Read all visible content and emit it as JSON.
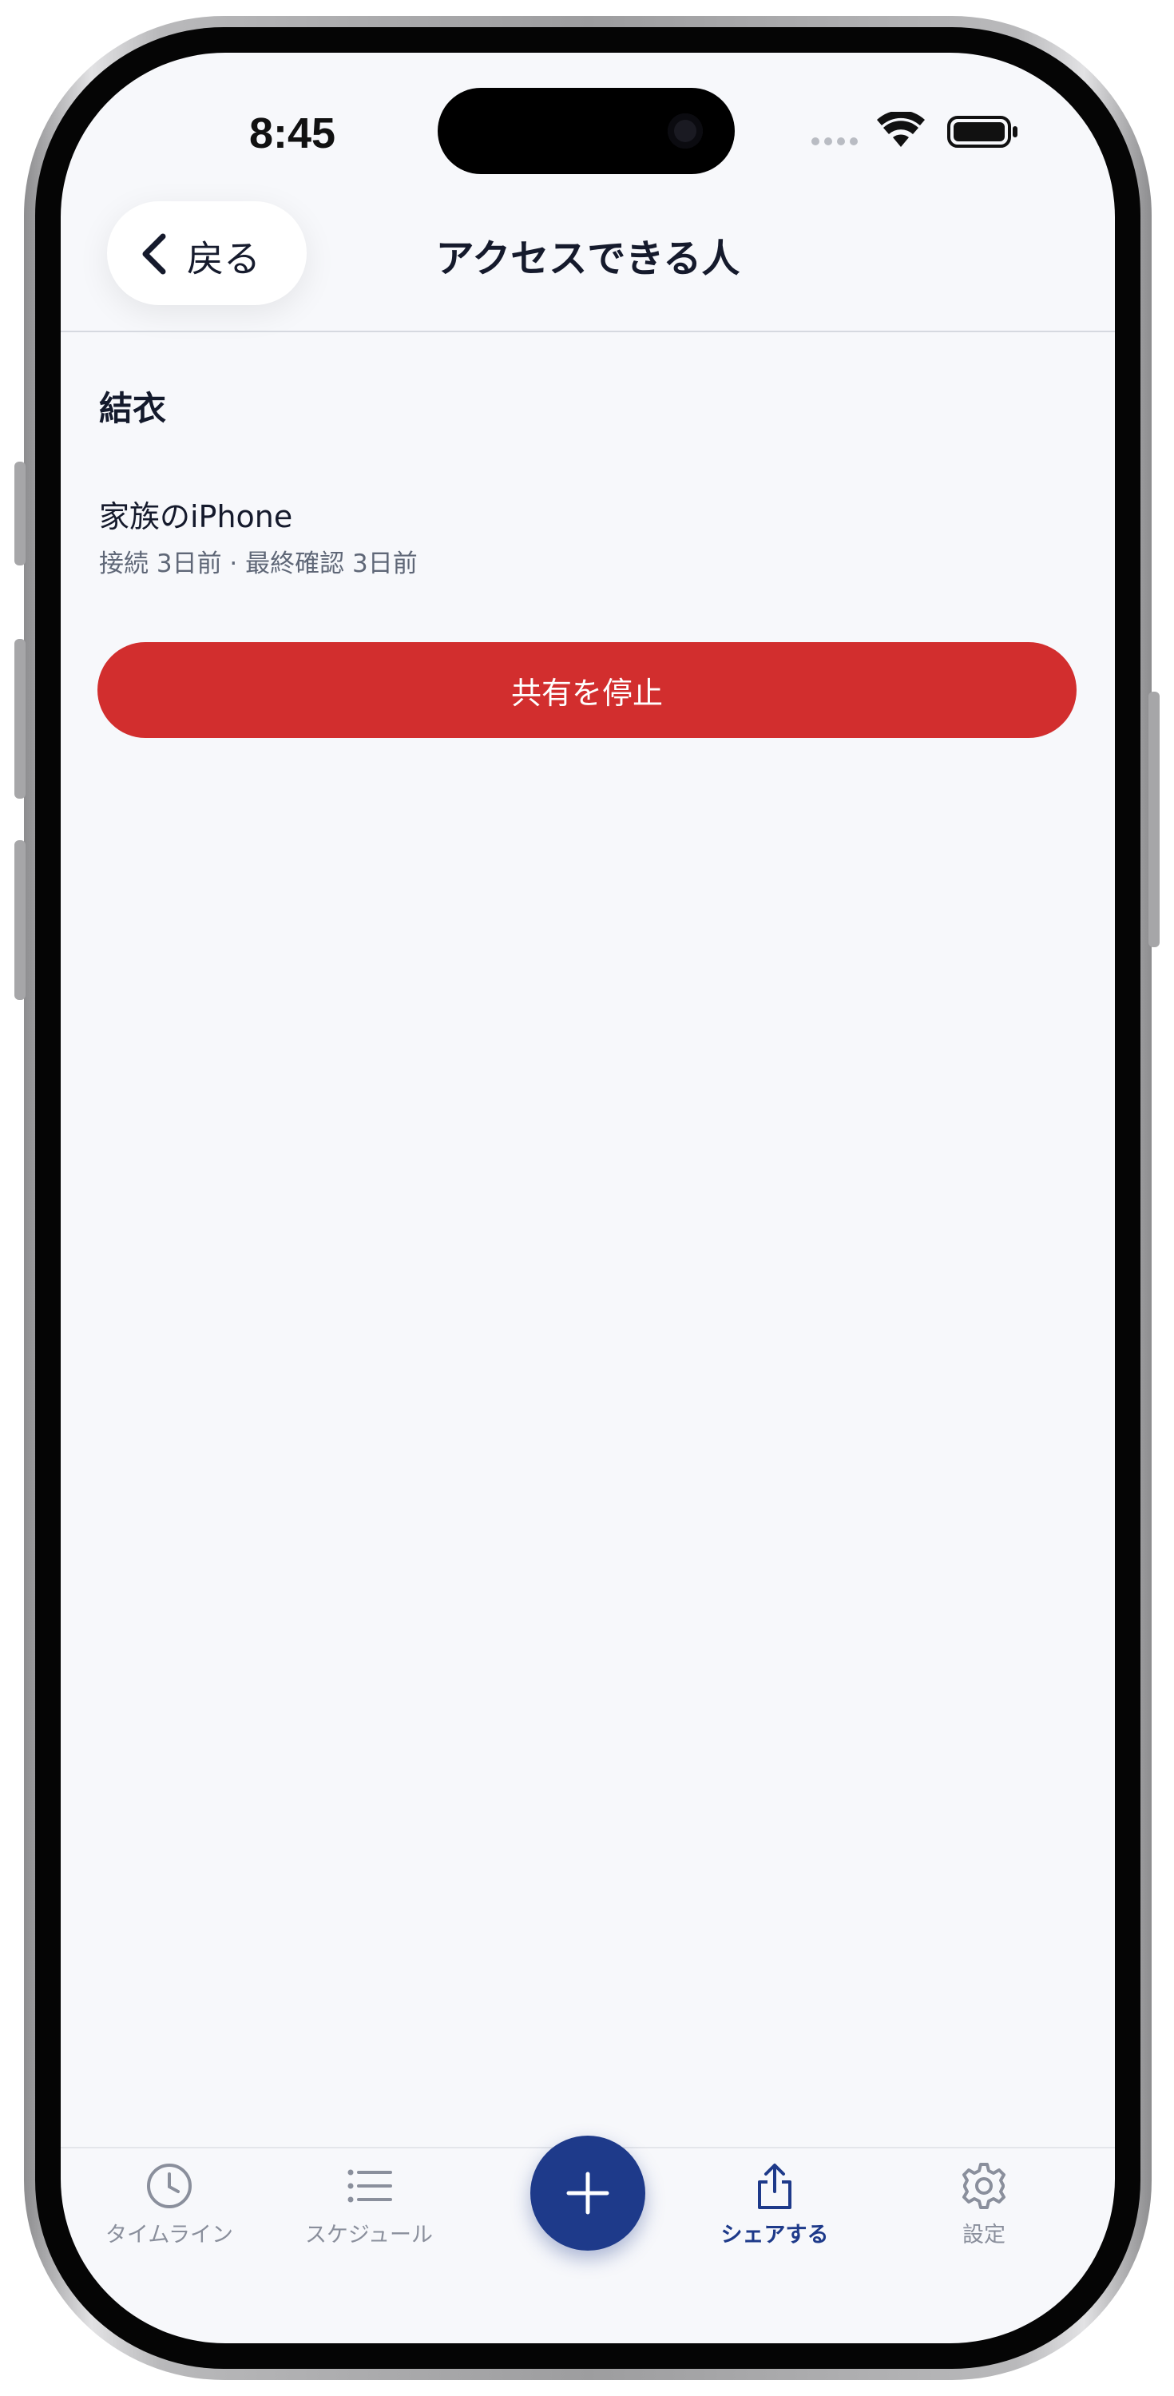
{
  "status_bar": {
    "time": "8:45"
  },
  "nav": {
    "back_label": "戻る",
    "title": "アクセスできる人"
  },
  "content": {
    "person_name": "結衣",
    "device_name": "家族のiPhone",
    "device_meta": "接続 3日前 · 最終確認 3日前",
    "stop_sharing_label": "共有を停止"
  },
  "tab_bar": {
    "items": [
      {
        "label": "タイムライン",
        "icon": "clock-icon",
        "active": false
      },
      {
        "label": "スケジュール",
        "icon": "list-icon",
        "active": false
      },
      {
        "label": "シェアする",
        "icon": "share-icon",
        "active": true
      },
      {
        "label": "設定",
        "icon": "gear-icon",
        "active": false
      }
    ],
    "fab_icon": "plus-icon"
  },
  "colors": {
    "accent": "#1e3a8a",
    "danger": "#d22e2e",
    "background": "#f7f8fb"
  }
}
